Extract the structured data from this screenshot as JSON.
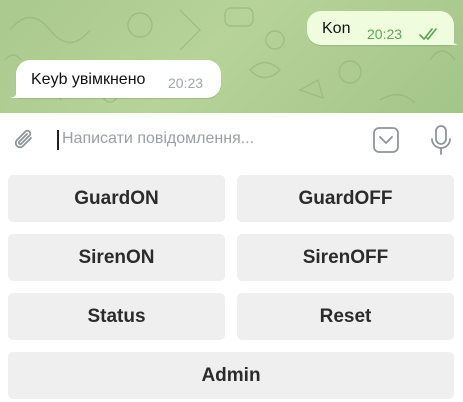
{
  "chat": {
    "outgoing": {
      "text": "Kon",
      "time": "20:23",
      "status_icon": "double-check-icon"
    },
    "incoming": {
      "text": "Keyb увімкнено",
      "time": "20:23"
    }
  },
  "composer": {
    "placeholder": "Написати повідомлення...",
    "attach_icon": "paperclip-icon",
    "keyboard_icon": "chevron-down-icon",
    "mic_icon": "microphone-icon"
  },
  "keyboard": {
    "rows": [
      [
        "GuardON",
        "GuardOFF"
      ],
      [
        "SirenON",
        "SirenOFF"
      ],
      [
        "Status",
        "Reset"
      ],
      [
        "Admin"
      ]
    ]
  },
  "colors": {
    "chat_background": "#a9c98e",
    "outgoing_bubble": "#effdde",
    "incoming_bubble": "#ffffff",
    "read_check": "#5fa656",
    "keyboard_button": "#efefef"
  }
}
